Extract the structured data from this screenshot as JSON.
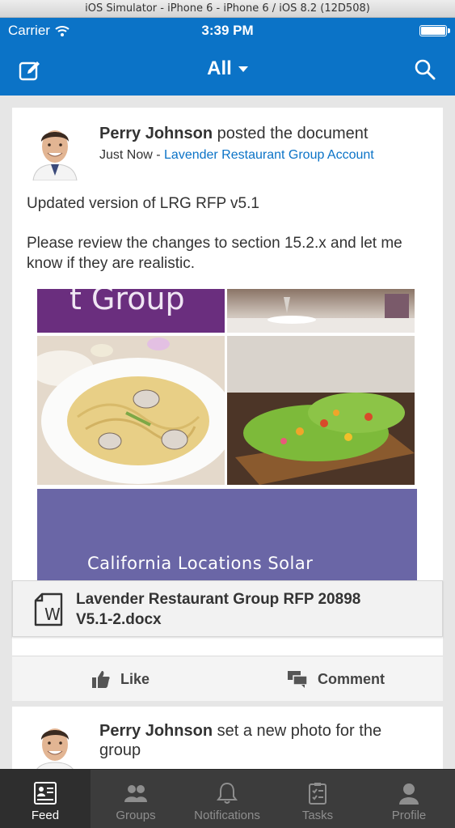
{
  "simulator": {
    "title": "iOS Simulator - iPhone 6 - iPhone 6 / iOS 8.2 (12D508)"
  },
  "status_bar": {
    "carrier": "Carrier",
    "time": "3:39 PM"
  },
  "nav": {
    "title": "All"
  },
  "post": {
    "author": "Perry Johnson",
    "action": " posted the document",
    "timestamp": "Just Now",
    "separator": " - ",
    "context": "Lavender Restaurant Group Account",
    "body_line1": "Updated version of LRG RFP v5.1",
    "body_line2": "Please review the changes to section 15.2.x and let me know if they are realistic.",
    "preview_header_text": "t Group",
    "preview_banner_text": "California Locations Solar",
    "attachment_name": "Lavender Restaurant Group RFP 20898 V5.1-2.docx"
  },
  "actions": {
    "like": "Like",
    "comment": "Comment"
  },
  "post2": {
    "author": "Perry Johnson",
    "action": " set a new photo for the group"
  },
  "tabs": [
    {
      "label": "Feed",
      "icon": "feed-icon",
      "active": true
    },
    {
      "label": "Groups",
      "icon": "groups-icon",
      "active": false
    },
    {
      "label": "Notifications",
      "icon": "bell-icon",
      "active": false
    },
    {
      "label": "Tasks",
      "icon": "tasks-icon",
      "active": false
    },
    {
      "label": "Profile",
      "icon": "profile-icon",
      "active": false
    }
  ],
  "colors": {
    "accent": "#0b73c7",
    "tabbar": "#3c3c3c",
    "link": "#0b73c7"
  }
}
